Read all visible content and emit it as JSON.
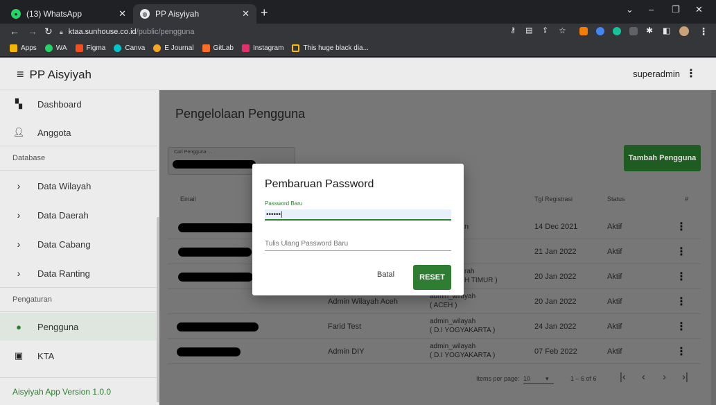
{
  "browser": {
    "tabs": [
      {
        "title": "(13) WhatsApp",
        "icon": "whatsapp-icon",
        "color": "#25d366",
        "active": false
      },
      {
        "title": "PP Aisyiyah",
        "icon": "globe-icon",
        "color": "#e8eaed",
        "active": true
      }
    ],
    "new_tab": "+",
    "url_host": "ktaa.sunhouse.co.id",
    "url_path": "/public/pengguna",
    "bookmarks": [
      {
        "label": "Apps",
        "icon": "apps-grid-icon",
        "color": "#f4b400"
      },
      {
        "label": "WA",
        "icon": "whatsapp-icon",
        "color": "#25d366"
      },
      {
        "label": "Figma",
        "icon": "figma-icon",
        "color": "#f24e1e"
      },
      {
        "label": "Canva",
        "icon": "canva-icon",
        "color": "#00c4cc"
      },
      {
        "label": "E Journal",
        "icon": "journal-icon",
        "color": "#f6a623"
      },
      {
        "label": "GitLab",
        "icon": "gitlab-icon",
        "color": "#fc6d26"
      },
      {
        "label": "Instagram",
        "icon": "instagram-icon",
        "color": "#e1306c"
      },
      {
        "label": "This huge black dia...",
        "icon": "bookmark-page-icon",
        "color": "#fbbc04"
      }
    ]
  },
  "app": {
    "brand": "PP Aisyiyah",
    "username": "superadmin",
    "sidebar": {
      "items_top": [
        {
          "label": "Dashboard",
          "icon": "dashboard-icon"
        },
        {
          "label": "Anggota",
          "icon": "person-icon"
        }
      ],
      "section_database": "Database",
      "items_database": [
        {
          "label": "Data Wilayah",
          "icon": "chevron-right-icon"
        },
        {
          "label": "Data Daerah",
          "icon": "chevron-right-icon"
        },
        {
          "label": "Data Cabang",
          "icon": "chevron-right-icon"
        },
        {
          "label": "Data Ranting",
          "icon": "chevron-right-icon"
        }
      ],
      "section_settings": "Pengaturan",
      "items_settings": [
        {
          "label": "Pengguna",
          "icon": "account-circle-icon",
          "active": true
        },
        {
          "label": "KTA",
          "icon": "id-badge-icon",
          "active": false
        }
      ],
      "footer": "Aisyiyah App Version 1.0.0"
    },
    "main": {
      "title": "Pengelolaan Pengguna",
      "search_label": "Cari Pengguna ...",
      "add_button": "Tambah Pengguna",
      "columns": {
        "email": "Email",
        "registered": "Tgl Registrasi",
        "status": "Status",
        "actions": "#"
      },
      "rows": [
        {
          "name": "",
          "role": "n",
          "date": "14 Dec 2021",
          "status": "Aktif"
        },
        {
          "name": "",
          "role": "",
          "date": "21 Jan 2022",
          "status": "Aktif"
        },
        {
          "name": "",
          "role": "rah",
          "role2": "H TIMUR )",
          "date": "20 Jan 2022",
          "status": "Aktif"
        },
        {
          "name": "Admin Wilayah Aceh",
          "role": "admin_wilayah",
          "role2": "( ACEH )",
          "date": "20 Jan 2022",
          "status": "Aktif"
        },
        {
          "name": "Farid Test",
          "role": "admin_wilayah",
          "role2": "( D.I YOGYAKARTA )",
          "date": "24 Jan 2022",
          "status": "Aktif"
        },
        {
          "name": "Admin DIY",
          "role": "admin_wilayah",
          "role2": "( D.I YOGYAKARTA )",
          "date": "07 Feb 2022",
          "status": "Aktif"
        }
      ],
      "pagination": {
        "items_per_page_label": "Items per page:",
        "items_per_page": "10",
        "range": "1 – 6 of 6"
      }
    },
    "dialog": {
      "title": "Pembaruan Password",
      "new_password_label": "Password Baru",
      "new_password_value": "••••••|",
      "repeat_placeholder": "Tulis Ulang Password Baru",
      "cancel": "Batal",
      "reset": "RESET"
    }
  }
}
